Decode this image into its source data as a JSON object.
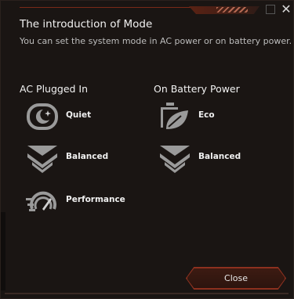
{
  "window": {
    "title": "The introduction of Mode",
    "subtitle": "You can set the system mode in AC power or on battery power."
  },
  "ac": {
    "heading": "AC Plugged In",
    "modes": [
      {
        "label": "Quiet",
        "icon": "quiet-moon-icon"
      },
      {
        "label": "Balanced",
        "icon": "balanced-chevron-icon"
      },
      {
        "label": "Performance",
        "icon": "performance-speedometer-icon"
      }
    ]
  },
  "battery": {
    "heading": "On Battery Power",
    "modes": [
      {
        "label": "Eco",
        "icon": "eco-battery-leaf-icon"
      },
      {
        "label": "Balanced",
        "icon": "balanced-chevron-icon"
      }
    ]
  },
  "buttons": {
    "close": "Close"
  },
  "colors": {
    "accent": "#8f3220",
    "icon": "#9a9a9a",
    "background": "#1a1513"
  }
}
